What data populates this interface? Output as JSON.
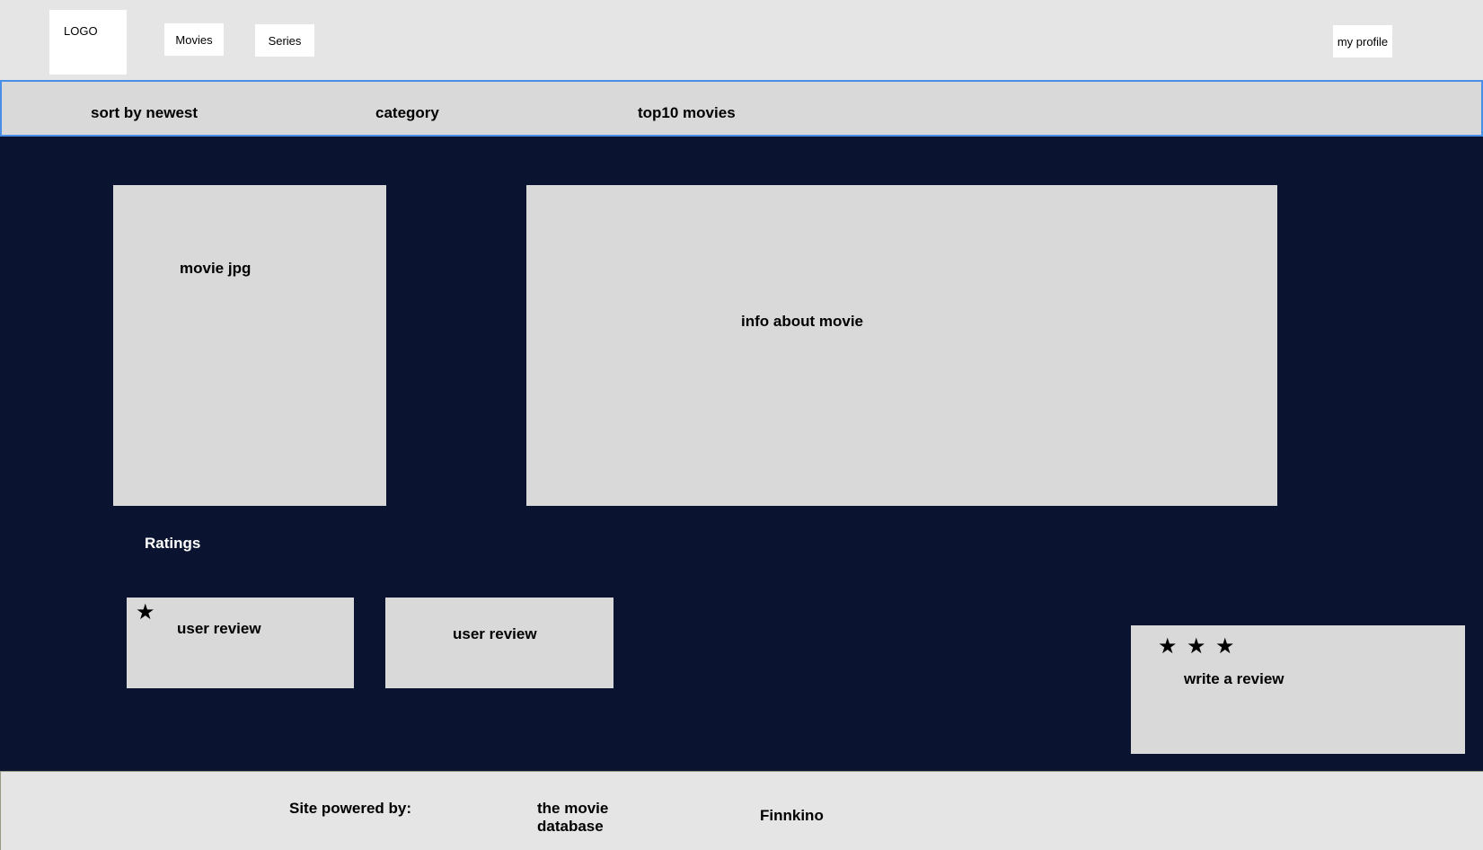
{
  "header": {
    "logo": "LOGO",
    "nav": {
      "movies": "Movies",
      "series": "Series"
    },
    "profile": "my profile"
  },
  "subnav": {
    "sort": "sort by newest",
    "category": "category",
    "top10": "top10 movies"
  },
  "main": {
    "poster_label": "movie jpg",
    "info_label": "info about movie",
    "ratings_title": "Ratings",
    "reviews": [
      {
        "label": "user review",
        "stars": 1
      },
      {
        "label": "user review",
        "stars": 0
      }
    ],
    "write_review": {
      "label": "write a review",
      "stars": 3
    }
  },
  "footer": {
    "powered_by": "Site powered by:",
    "tmdb": "the movie database",
    "finnkino": "Finnkino"
  },
  "colors": {
    "background": "#0a1430",
    "panel": "#d9d9d9",
    "header": "#e5e5e5",
    "accent_border": "#4a8fe7"
  }
}
